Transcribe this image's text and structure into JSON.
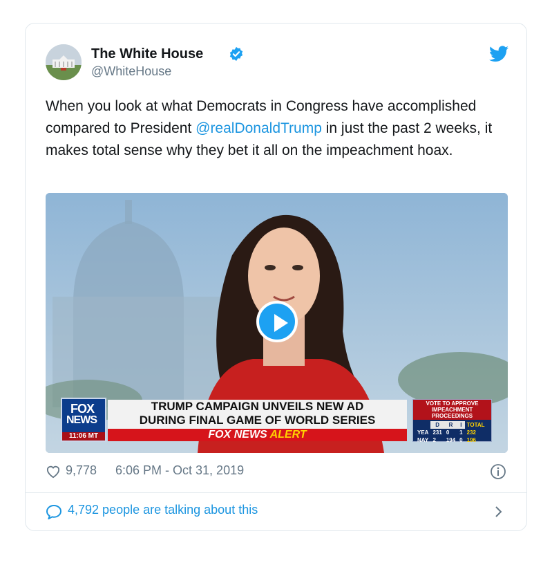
{
  "tweet": {
    "author_name": "The White House",
    "author_handle": "@WhiteHouse",
    "text_before": "When you look at what Democrats in Congress have accomplished compared to President ",
    "mention": "@realDonaldTrump",
    "text_after": " in just the past 2 weeks, it makes total sense why they bet it all on the impeachment hoax.",
    "likes": "9,778",
    "timestamp": "6:06 PM - Oct 31, 2019",
    "talking": "4,792 people are talking about this"
  },
  "video": {
    "logo_line1": "FOX",
    "logo_line2": "NEWS",
    "logo_time": "11:06 MT",
    "headline_line1": "TRUMP CAMPAIGN UNVEILS NEW AD",
    "headline_line2": "DURING FINAL GAME OF WORLD SERIES",
    "alert_brand": "FOX NEWS",
    "alert_word": "ALERT",
    "vote_title_1": "VOTE TO APPROVE",
    "vote_title_2": "IMPEACHMENT PROCEEDINGS",
    "vote_headers": [
      "D",
      "R",
      "I",
      "TOTAL"
    ],
    "vote_rows": [
      {
        "label": "YEA",
        "d": "231",
        "r": "0",
        "i": "1",
        "total": "232"
      },
      {
        "label": "NAY",
        "d": "2",
        "r": "194",
        "i": "0",
        "total": "196"
      }
    ]
  },
  "colors": {
    "link": "#1b95e0",
    "secondary_text": "#657786",
    "twitter_blue": "#1da1f2",
    "border": "#e1e8ed"
  },
  "icons": [
    "verified-badge-icon",
    "twitter-bird-icon",
    "play-icon",
    "heart-icon",
    "info-icon",
    "speech-bubble-icon",
    "chevron-right-icon"
  ]
}
